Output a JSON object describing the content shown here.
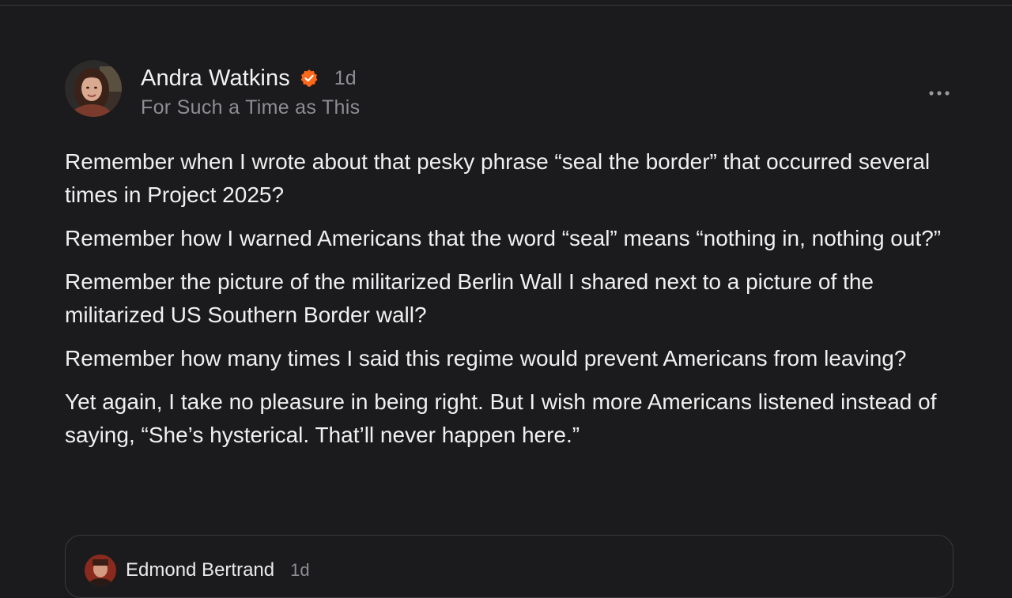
{
  "post": {
    "author": "Andra Watkins",
    "time": "1d",
    "publication": "For Such a Time as This",
    "paragraphs": [
      "Remember when I wrote about that pesky phrase “seal the border” that occurred several times in Project 2025?",
      "Remember how I warned Americans that the word “seal” means “nothing in, nothing out?”",
      "Remember the picture of the militarized Berlin Wall I shared next to a picture of the militarized US Southern Border wall?",
      "Remember how many times I said this regime would prevent Americans from leaving?",
      "Yet again, I take no pleasure in being right. But I wish more Americans listened instead of saying, “She’s hysterical. That’ll never happen here.”"
    ],
    "icons": {
      "verified": "verified-badge-icon",
      "more": "more-options-icon"
    }
  },
  "quoted": {
    "author": "Edmond Bertrand",
    "time": "1d"
  },
  "colors": {
    "background": "#1b1b1d",
    "accent": "#ff6719",
    "muted": "#8e8e93"
  }
}
